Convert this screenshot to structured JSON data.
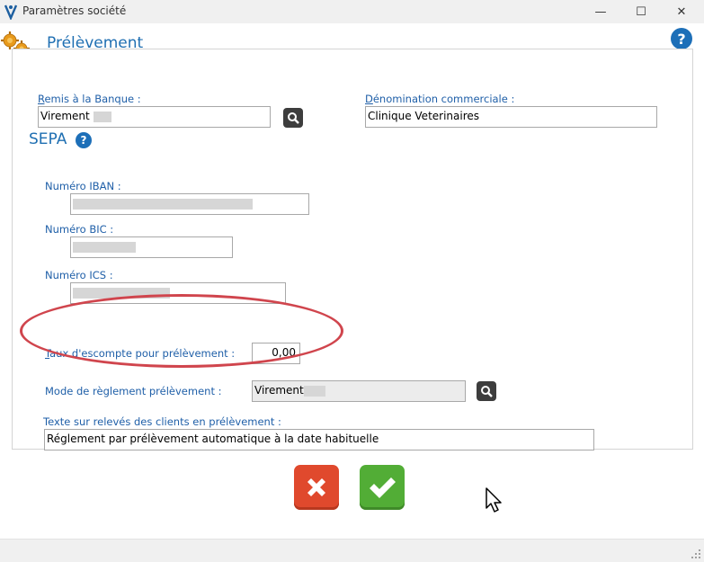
{
  "window": {
    "title": "Paramètres société",
    "minimize": "—",
    "maximize": "☐",
    "close": "✕"
  },
  "header": {
    "title": "Prélèvement",
    "help": "?"
  },
  "form": {
    "bank_label_u": "R",
    "bank_label_rest": "emis à la Banque :",
    "bank_value": "Virement",
    "trade_label_u": "D",
    "trade_label_rest": "énomination commerciale :",
    "trade_value": "Clinique Veterinaires",
    "sepa_title": "SEPA",
    "sepa_help": "?",
    "iban_label": "Numéro IBAN :",
    "bic_label": "Numéro BIC :",
    "ics_label": "Numéro ICS :",
    "discount_label_u": "T",
    "discount_label_rest": "aux d'escompte pour prélèvement :",
    "discount_value": "0,00",
    "mode_label": "Mode de règlement prélèvement :",
    "mode_value": "Virement",
    "statement_label": "Texte sur relevés des clients en prélèvement :",
    "statement_value": "Réglement par prélèvement automatique à la date habituelle"
  },
  "colors": {
    "accent_blue": "#1f6fb2",
    "cancel_red": "#e0492d",
    "ok_green": "#52ad36",
    "annotation_red": "#d0454d"
  }
}
